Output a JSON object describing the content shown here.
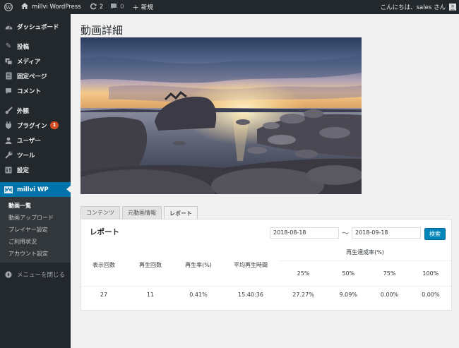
{
  "adminbar": {
    "site_name": "millvi WordPress",
    "updates_count": "2",
    "comments_count": "0",
    "new_label": "新規",
    "greeting": "こんにちは、sales さん"
  },
  "sidebar": {
    "items": [
      {
        "label": "ダッシュボード",
        "icon": "dashboard-icon"
      },
      {
        "label": "投稿",
        "icon": "pin-icon"
      },
      {
        "label": "メディア",
        "icon": "media-icon"
      },
      {
        "label": "固定ページ",
        "icon": "page-icon"
      },
      {
        "label": "コメント",
        "icon": "comment-icon"
      },
      {
        "label": "外観",
        "icon": "brush-icon"
      },
      {
        "label": "プラグイン",
        "icon": "plugin-icon",
        "badge": "1"
      },
      {
        "label": "ユーザー",
        "icon": "user-icon"
      },
      {
        "label": "ツール",
        "icon": "wrench-icon"
      },
      {
        "label": "設定",
        "icon": "settings-icon"
      },
      {
        "label": "millvi WP",
        "icon": "millvi-icon"
      }
    ],
    "submenu": [
      "動画一覧",
      "動画アップロード",
      "プレイヤー設定",
      "ご利用状況",
      "アカウント設定"
    ],
    "collapse_label": "メニューを閉じる"
  },
  "page": {
    "title": "動画詳細",
    "tabs": [
      "コンテンツ",
      "元動画情報",
      "レポート"
    ]
  },
  "report": {
    "title": "レポート",
    "date_from": "2018-08-18",
    "tilde": "〜",
    "date_to": "2018-09-18",
    "search_label": "検索",
    "headers": {
      "views": "表示回数",
      "plays": "再生回数",
      "play_rate": "再生率(%)",
      "avg_time": "平均再生時間",
      "completion": "再生達成率(%)",
      "p25": "25%",
      "p50": "50%",
      "p75": "75%",
      "p100": "100%"
    },
    "row": {
      "views": "27",
      "plays": "11",
      "play_rate": "0.41%",
      "avg_time": "15:40:36",
      "p25": "27.27%",
      "p50": "9.09%",
      "p75": "0.00%",
      "p100": "0.00%"
    }
  },
  "colors": {
    "accent": "#0073aa",
    "adminbar": "#23282d",
    "button": "#0085ba"
  }
}
